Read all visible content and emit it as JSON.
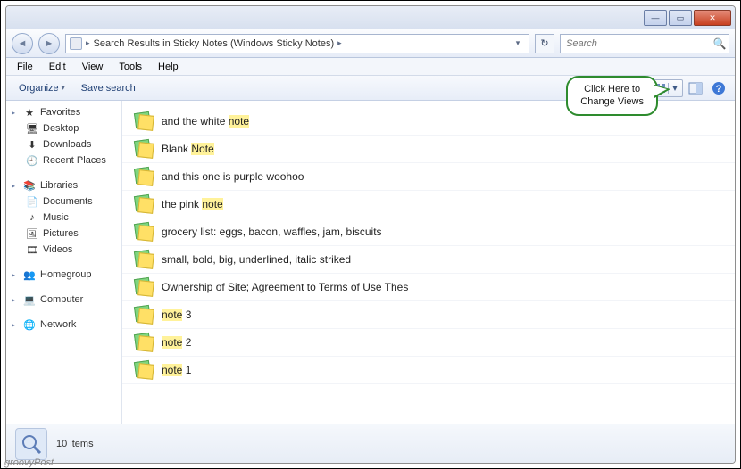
{
  "titlebar": {
    "min": "—",
    "max": "▭",
    "close": "✕"
  },
  "address": {
    "path": "Search Results in Sticky Notes (Windows Sticky Notes)",
    "sep": "▸",
    "drop": "▾",
    "refresh": "↻"
  },
  "search": {
    "placeholder": "Search",
    "icon": "🔍"
  },
  "menu": {
    "file": "File",
    "edit": "Edit",
    "view": "View",
    "tools": "Tools",
    "help": "Help"
  },
  "toolbar": {
    "organize": "Organize",
    "save": "Save search"
  },
  "callout": {
    "line1": "Click Here to",
    "line2": "Change Views"
  },
  "nav": {
    "favorites": {
      "label": "Favorites",
      "items": [
        {
          "label": "Desktop"
        },
        {
          "label": "Downloads"
        },
        {
          "label": "Recent Places"
        }
      ]
    },
    "libraries": {
      "label": "Libraries",
      "items": [
        {
          "label": "Documents"
        },
        {
          "label": "Music"
        },
        {
          "label": "Pictures"
        },
        {
          "label": "Videos"
        }
      ]
    },
    "homegroup": {
      "label": "Homegroup"
    },
    "computer": {
      "label": "Computer"
    },
    "network": {
      "label": "Network"
    }
  },
  "results": [
    {
      "pre": "and the white ",
      "hl": "note",
      "post": ""
    },
    {
      "pre": "Blank ",
      "hl": "Note",
      "post": ""
    },
    {
      "pre": "and this one is purple woohoo",
      "hl": "",
      "post": ""
    },
    {
      "pre": "the pink ",
      "hl": "note",
      "post": ""
    },
    {
      "pre": "grocery list: eggs, bacon, waffles, jam, biscuits",
      "hl": "",
      "post": ""
    },
    {
      "pre": "small, bold,  big,  underlined, italic striked",
      "hl": "",
      "post": ""
    },
    {
      "pre": "Ownership of Site; Agreement to Terms of Use Thes",
      "hl": "",
      "post": ""
    },
    {
      "pre": "",
      "hl": "note",
      "post": " 3"
    },
    {
      "pre": "",
      "hl": "note",
      "post": " 2"
    },
    {
      "pre": "",
      "hl": "note",
      "post": " 1"
    }
  ],
  "status": {
    "count": "10 items"
  },
  "watermark": "groovyPost"
}
